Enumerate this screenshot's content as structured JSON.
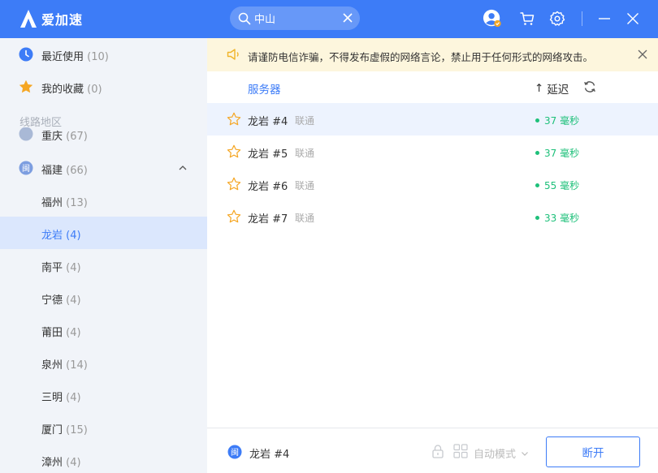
{
  "app": {
    "name": "爱加速"
  },
  "search": {
    "value": "中山"
  },
  "sidebar": {
    "recent": {
      "label": "最近使用",
      "count": "(10)"
    },
    "favorites": {
      "label": "我的收藏",
      "count": "(0)"
    },
    "section_title": "线路地区",
    "clipped": {
      "label": "重庆",
      "count": "(67)"
    },
    "province": {
      "label": "福建",
      "count": "(66)",
      "icon_char": "闽"
    },
    "cities": [
      {
        "label": "福州",
        "count": "(13)"
      },
      {
        "label": "龙岩",
        "count": "(4)"
      },
      {
        "label": "南平",
        "count": "(4)"
      },
      {
        "label": "宁德",
        "count": "(4)"
      },
      {
        "label": "莆田",
        "count": "(4)"
      },
      {
        "label": "泉州",
        "count": "(14)"
      },
      {
        "label": "三明",
        "count": "(4)"
      },
      {
        "label": "厦门",
        "count": "(15)"
      },
      {
        "label": "漳州",
        "count": "(4)"
      }
    ],
    "selected_city": "龙岩"
  },
  "notice": {
    "text": "请谨防电信诈骗，不得发布虚假的网络言论，禁止用于任何形式的网络攻击。"
  },
  "list": {
    "header": {
      "title": "服务器",
      "sort_arrow": "↑",
      "sort_label": "延迟"
    },
    "servers": [
      {
        "name": "龙岩 #4",
        "isp": "联通",
        "latency": "37 毫秒"
      },
      {
        "name": "龙岩 #5",
        "isp": "联通",
        "latency": "37 毫秒"
      },
      {
        "name": "龙岩 #6",
        "isp": "联通",
        "latency": "55 毫秒"
      },
      {
        "name": "龙岩 #7",
        "isp": "联通",
        "latency": "33 毫秒"
      }
    ]
  },
  "footer": {
    "current_server": "龙岩 #4",
    "region_icon_char": "闽",
    "mode_label": "自动模式",
    "disconnect_label": "断开"
  },
  "colors": {
    "accent": "#3d7cf7",
    "latency_good": "#1ec07a",
    "notice_bg": "#fdf6dd",
    "star": "#f5a623"
  }
}
